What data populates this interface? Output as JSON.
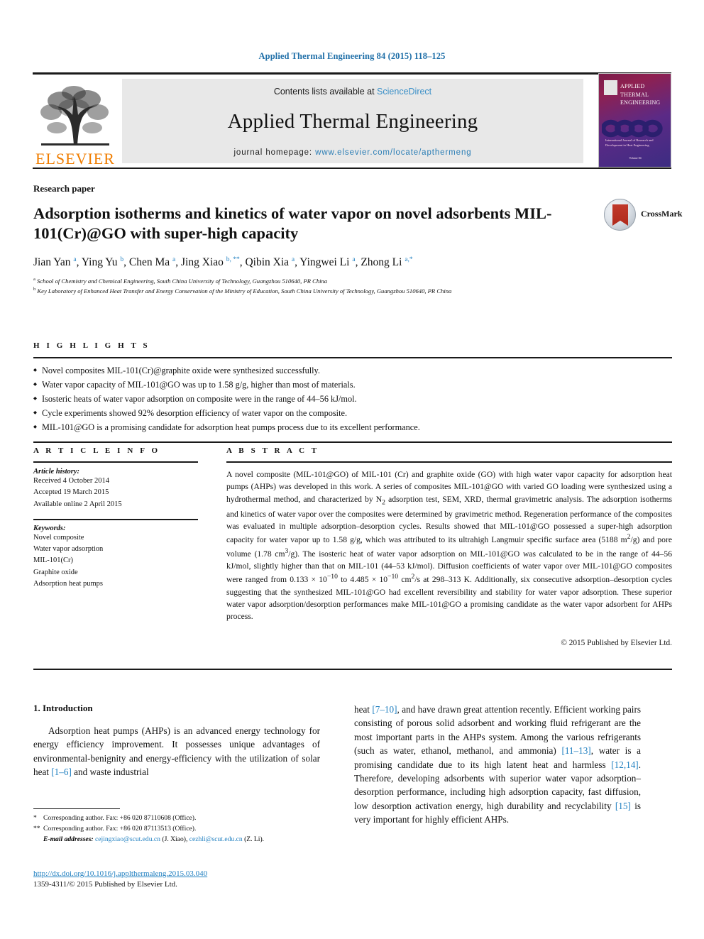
{
  "running_head": "Applied Thermal Engineering 84 (2015) 118–125",
  "masthead": {
    "contents_prefix": "Contents lists available at ",
    "contents_link": "ScienceDirect",
    "journal_name": "Applied Thermal Engineering",
    "homepage_prefix": "journal homepage: ",
    "homepage_url": "www.elsevier.com/locate/apthermeng",
    "publisher_logo_text": "ELSEVIER",
    "cover_title_lines": [
      "APPLIED",
      "THERMAL",
      "ENGINEERING"
    ],
    "cover_footer": "International Journal of Research and Development in Heat Engineering",
    "cover_volume": "Volume 84"
  },
  "article": {
    "doc_type": "Research paper",
    "title": "Adsorption isotherms and kinetics of water vapor on novel adsorbents MIL-101(Cr)@GO with super-high capacity",
    "authors_html": "Jian Yan <sup>a</sup>, Ying Yu <sup>b</sup>, Chen Ma <sup>a</sup>, Jing Xiao <sup>b, **</sup>, Qibin Xia <sup>a</sup>, Yingwei Li <sup>a</sup>, Zhong Li <sup>a,*</sup>",
    "affiliation_a": "School of Chemistry and Chemical Engineering, South China University of Technology, Guangzhou 510640, PR China",
    "affiliation_b": "Key Laboratory of Enhanced Heat Transfer and Energy Conservation of the Ministry of Education, South China University of Technology, Guangzhou 510640, PR China",
    "crossmark_label": "CrossMark"
  },
  "highlights": {
    "heading": "H I G H L I G H T S",
    "items": [
      "Novel composites MIL-101(Cr)@graphite oxide were synthesized successfully.",
      "Water vapor capacity of MIL-101@GO was up to 1.58 g/g, higher than most of materials.",
      "Isosteric heats of water vapor adsorption on composite were in the range of 44–56 kJ/mol.",
      "Cycle experiments showed 92% desorption efficiency of water vapor on the composite.",
      "MIL-101@GO is a promising candidate for adsorption heat pumps process due to its excellent performance."
    ]
  },
  "article_info": {
    "heading": "A R T I C L E   I N F O",
    "history_label": "Article history:",
    "history": [
      "Received 4 October 2014",
      "Accepted 19 March 2015",
      "Available online 2 April 2015"
    ],
    "keywords_label": "Keywords:",
    "keywords": [
      "Novel composite",
      "Water vapor adsorption",
      "MIL-101(Cr)",
      "Graphite oxide",
      "Adsorption heat pumps"
    ]
  },
  "abstract": {
    "heading": "A B S T R A C T",
    "body_html": "A novel composite (MIL-101@GO) of MIL-101 (Cr) and graphite oxide (GO) with high water vapor capacity for adsorption heat pumps (AHPs) was developed in this work. A series of composites MIL-101@GO with varied GO loading were synthesized using a hydrothermal method, and characterized by N<sub>2</sub> adsorption test, SEM, XRD, thermal gravimetric analysis. The adsorption isotherms and kinetics of water vapor over the composites were determined by gravimetric method. Regeneration performance of the composites was evaluated in multiple adsorption–desorption cycles. Results showed that MIL-101@GO possessed a super-high adsorption capacity for water vapor up to 1.58 g/g, which was attributed to its ultrahigh Langmuir specific surface area (5188 m<sup>2</sup>/g) and pore volume (1.78 cm<sup>3</sup>/g). The isosteric heat of water vapor adsorption on MIL-101@GO was calculated to be in the range of 44–56 kJ/mol, slightly higher than that on MIL-101 (44–53 kJ/mol). Diffusion coefficients of water vapor over MIL-101@GO composites were ranged from 0.133 × 10<sup>−10</sup> to 4.485 × 10<sup>−10</sup> cm<sup>2</sup>/s at 298–313 K. Additionally, six consecutive adsorption–desorption cycles suggesting that the synthesized MIL-101@GO had excellent reversibility and stability for water vapor adsorption. These superior water vapor adsorption/desorption performances make MIL-101@GO a promising candidate as the water vapor adsorbent for AHPs process.",
    "copyright": "© 2015 Published by Elsevier Ltd."
  },
  "introduction": {
    "heading": "1. Introduction",
    "left_paragraph_html": "Adsorption heat pumps (AHPs) is an advanced energy technology for energy efficiency improvement. It possesses unique advantages of environmental-benignity and energy-efficiency with the utilization of solar heat <span class=\"ref\">[1–6]</span> and waste industrial",
    "right_paragraph_html": "heat <span class=\"ref\">[7–10]</span>, and have drawn great attention recently. Efficient working pairs consisting of porous solid adsorbent and working fluid refrigerant are the most important parts in the AHPs system. Among the various refrigerants (such as water, ethanol, methanol, and ammonia) <span class=\"ref\">[11–13]</span>, water is a promising candidate due to its high latent heat and harmless <span class=\"ref\">[12,14]</span>. Therefore, developing adsorbents with superior water vapor adsorption–desorption performance, including high adsorption capacity, fast diffusion, low desorption activation energy, high durability and recyclability <span class=\"ref\">[15]</span> is very important for highly efficient AHPs."
  },
  "footnotes": {
    "corresponding_1_mark": "*",
    "corresponding_1": "Corresponding author. Fax: +86 020 87110608 (Office).",
    "corresponding_2_mark": "**",
    "corresponding_2": "Corresponding author. Fax: +86 020 87113513 (Office).",
    "email_label": "E-mail addresses:",
    "email_1": "cejingxiao@scut.edu.cn",
    "email_1_name": "(J. Xiao)",
    "email_2": "cezhli@scut.edu.cn",
    "email_2_name": "(Z. Li).",
    "doi": "http://dx.doi.org/10.1016/j.applthermaleng.2015.03.040",
    "issn_line": "1359-4311/© 2015 Published by Elsevier Ltd."
  },
  "colors": {
    "link": "#1f7fc0",
    "elsevier_orange": "#f07d00",
    "masthead_bg": "#e8e8e8",
    "rule": "#1a1a1a"
  }
}
